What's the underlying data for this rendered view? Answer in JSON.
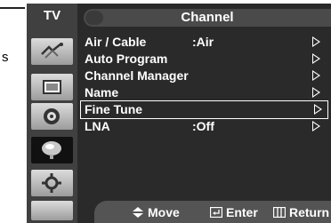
{
  "sidebar": {
    "title": "TV",
    "icons": [
      "picture-icon",
      "sound-icon",
      "channel-icon",
      "setup-icon",
      "input-icon",
      "application-icon"
    ]
  },
  "header": {
    "title": "Channel"
  },
  "menu": {
    "items": [
      {
        "label": "Air / Cable",
        "value": ":Air",
        "selected": false
      },
      {
        "label": "Auto Program",
        "value": "",
        "selected": false
      },
      {
        "label": "Channel Manager",
        "value": "",
        "selected": false
      },
      {
        "label": "Name",
        "value": "",
        "selected": false
      },
      {
        "label": "Fine Tune",
        "value": "",
        "selected": true
      },
      {
        "label": "LNA",
        "value": ":Off",
        "selected": false
      }
    ]
  },
  "footer": {
    "move": "Move",
    "enter": "Enter",
    "return": "Return"
  },
  "stray": {
    "letter": "s"
  }
}
